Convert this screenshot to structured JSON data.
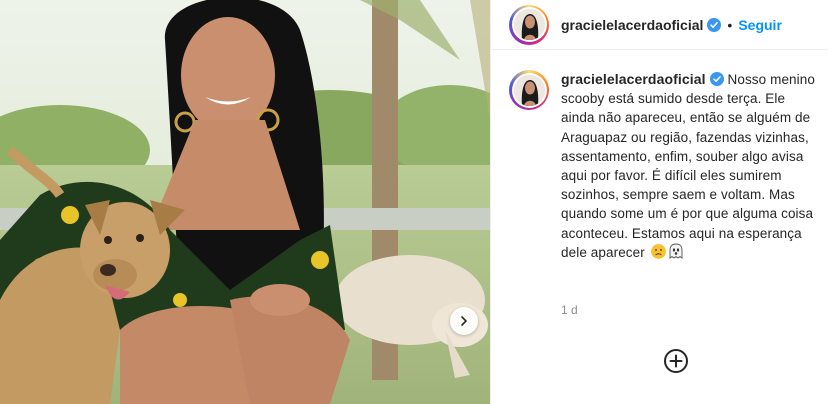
{
  "post": {
    "username": "gracielelacerdaoficial",
    "separator": "•",
    "follow_label": "Seguir",
    "caption": "Nosso menino scooby está sumido desde terça. Ele ainda não apareceu, então se alguém de Araguapaz ou região, fazendas vizinhas, assentamento, enfim, souber algo avisa aqui por favor. É difícil eles sumirem sozinhos, sempre saem e voltam. Mas quando some um é por que alguma coisa aconteceu. Estamos aqui na esperança dele aparecer",
    "time_ago": "1 d"
  },
  "icons": {
    "verified": "verified-badge-icon",
    "next": "chevron-right-icon",
    "add": "plus-circle-icon"
  },
  "colors": {
    "link_blue": "#0095f6",
    "verified_blue": "#3897f0",
    "muted": "#8e8e8e"
  }
}
